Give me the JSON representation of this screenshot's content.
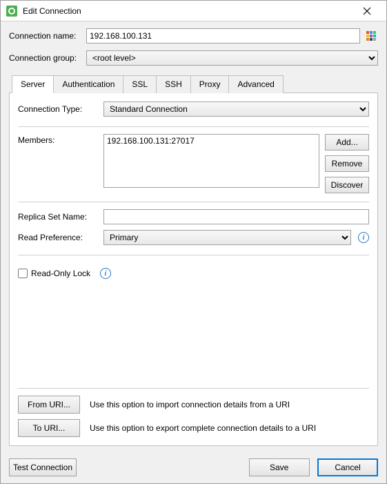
{
  "titlebar": {
    "title": "Edit Connection"
  },
  "form": {
    "connection_name_label": "Connection name:",
    "connection_name_value": "192.168.100.131",
    "connection_group_label": "Connection group:",
    "connection_group_value": "<root level>"
  },
  "tabs": {
    "server": "Server",
    "authentication": "Authentication",
    "ssl": "SSL",
    "ssh": "SSH",
    "proxy": "Proxy",
    "advanced": "Advanced"
  },
  "server_panel": {
    "connection_type_label": "Connection Type:",
    "connection_type_value": "Standard Connection",
    "members_label": "Members:",
    "members": [
      "192.168.100.131:27017"
    ],
    "add_btn": "Add...",
    "remove_btn": "Remove",
    "discover_btn": "Discover",
    "replica_set_label": "Replica Set Name:",
    "replica_set_value": "",
    "read_pref_label": "Read Preference:",
    "read_pref_value": "Primary",
    "read_only_lock_label": "Read-Only Lock",
    "from_uri_btn": "From URI...",
    "from_uri_desc": "Use this option to import connection details from a URI",
    "to_uri_btn": "To URI...",
    "to_uri_desc": "Use this option to export complete connection details to a URI"
  },
  "footer": {
    "test_btn": "Test Connection",
    "save_btn": "Save",
    "cancel_btn": "Cancel"
  }
}
